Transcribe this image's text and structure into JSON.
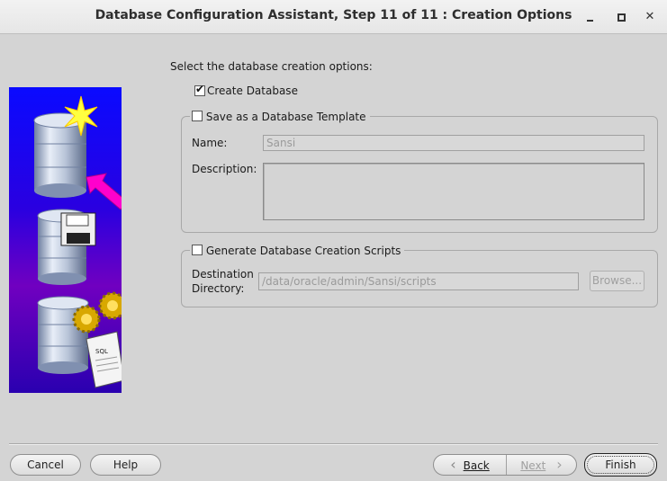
{
  "window": {
    "title": "Database Configuration Assistant, Step 11 of 11 : Creation Options",
    "minimize_label": "",
    "close_label": "✕"
  },
  "main": {
    "prompt": "Select the database creation options:",
    "create_database": {
      "label": "Create Database",
      "checked": true
    },
    "template": {
      "label": "Save as a Database Template",
      "checked": false,
      "name_label": "Name:",
      "name_value": "Sansi",
      "description_label": "Description:",
      "description_value": ""
    },
    "scripts": {
      "label": "Generate Database Creation Scripts",
      "checked": false,
      "dest_label_line1": "Destination",
      "dest_label_line2": "Directory:",
      "dest_value": "/data/oracle/admin/Sansi/scripts",
      "browse_label": "Browse..."
    }
  },
  "footer": {
    "cancel_label": "Cancel",
    "help_label": "Help",
    "back_label": "Back",
    "next_label": "Next",
    "finish_label": "Finish",
    "back_icon": "‹",
    "next_icon": "›"
  },
  "colors": {
    "background": "#d4d4d4",
    "image_blue": "#0a0aff",
    "image_purple": "#7000c0",
    "arrow_magenta": "#ff00cc"
  }
}
